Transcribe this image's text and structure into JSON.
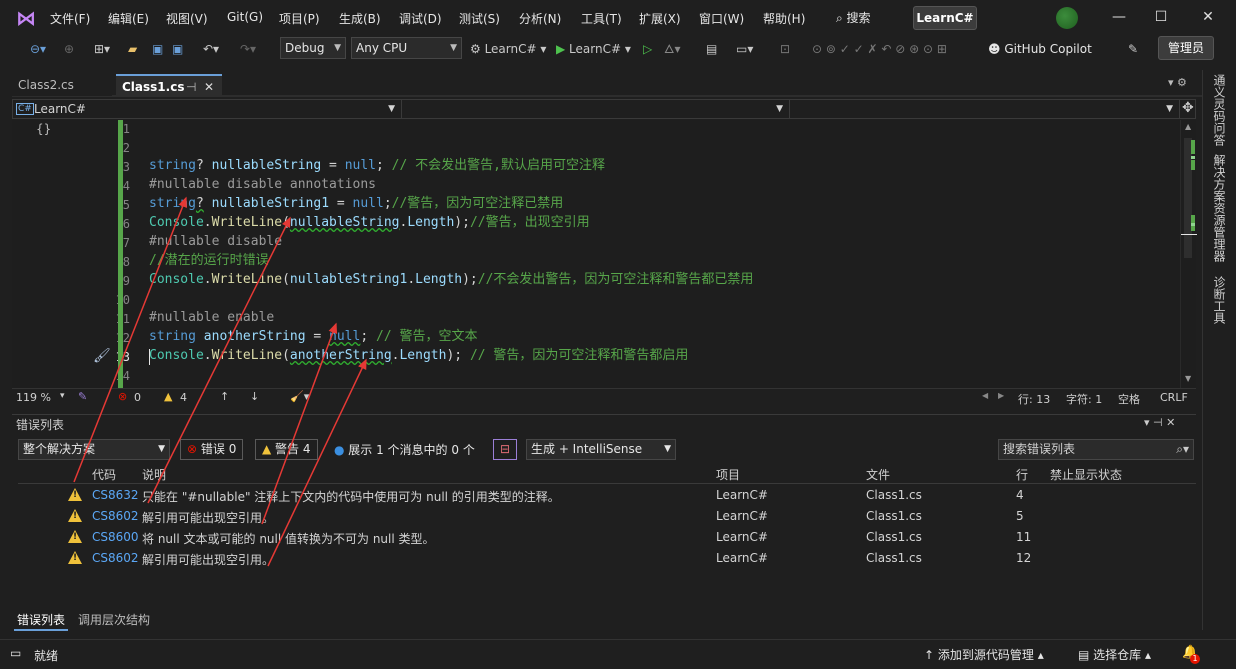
{
  "menu": [
    "文件(F)",
    "编辑(E)",
    "视图(V)",
    "Git(G)",
    "项目(P)",
    "生成(B)",
    "调试(D)",
    "测试(S)",
    "分析(N)",
    "工具(T)",
    "扩展(X)",
    "窗口(W)",
    "帮助(H)"
  ],
  "search_label": "搜索",
  "project_badge": "LearnC#",
  "toolbar": {
    "config": "Debug",
    "platform": "Any CPU",
    "startup_project": "LearnC#",
    "run_label": "LearnC#",
    "copilot": "GitHub Copilot",
    "admin": "管理员"
  },
  "tabs": [
    {
      "label": "Class2.cs",
      "active": false
    },
    {
      "label": "Class1.cs",
      "active": true
    }
  ],
  "right_dock": [
    "通义灵码问答",
    "解决方案资源管理器",
    "诊断工具"
  ],
  "navbar": {
    "project": "LearnC#",
    "type": "",
    "member": ""
  },
  "line_numbers": [
    "1",
    "2",
    "3",
    "4",
    "5",
    "6",
    "7",
    "8",
    "9",
    "10",
    "11",
    "12",
    "13",
    "14"
  ],
  "code_lines": [
    "",
    "string? nullableString = null; // 不会发出警告,默认启用可空注释",
    "#nullable disable annotations",
    "string? nullableString1 = null;//警告，因为可空注释已禁用",
    "Console.WriteLine(nullableString.Length);//警告，出现空引用",
    "#nullable disable",
    "//潜在的运行时错误",
    "Console.WriteLine(nullableString1.Length);//不会发出警告，因为可空注释和警告都已禁用",
    "",
    "#nullable enable",
    "string anotherString = null; // 警告，空文本",
    "Console.WriteLine(anotherString.Length); // 警告，因为可空注释和警告都启用",
    "",
    ""
  ],
  "editor_status": {
    "zoom": "119 %",
    "errors": "0",
    "warnings": "4",
    "line": "行: 13",
    "char": "字符: 1",
    "whitespace": "空格",
    "eol": "CRLF"
  },
  "error_list": {
    "title": "错误列表",
    "scope": "整个解决方案",
    "errors_btn": "错误 0",
    "warnings_btn": "警告 4",
    "messages": "展示 1 个消息中的 0 个",
    "build_filter": "生成 + IntelliSense",
    "search_placeholder": "搜索错误列表",
    "columns": [
      "代码",
      "说明",
      "项目",
      "文件",
      "行",
      "禁止显示状态"
    ],
    "rows": [
      {
        "code": "CS8632",
        "desc": "只能在 \"#nullable\" 注释上下文内的代码中使用可为 null 的引用类型的注释。",
        "project": "LearnC#",
        "file": "Class1.cs",
        "line": "4"
      },
      {
        "code": "CS8602",
        "desc": "解引用可能出现空引用。",
        "project": "LearnC#",
        "file": "Class1.cs",
        "line": "5"
      },
      {
        "code": "CS8600",
        "desc": "将 null 文本或可能的 null 值转换为不可为 null 类型。",
        "project": "LearnC#",
        "file": "Class1.cs",
        "line": "11"
      },
      {
        "code": "CS8602",
        "desc": "解引用可能出现空引用。",
        "project": "LearnC#",
        "file": "Class1.cs",
        "line": "12"
      }
    ]
  },
  "bottom_tabs": [
    "错误列表",
    "调用层次结构"
  ],
  "statusbar": {
    "ready": "就绪",
    "source_control": "添加到源代码管理",
    "repo": "选择仓库",
    "notifications": "1"
  },
  "colors": {
    "accent": "#6a9fd8",
    "warning": "#f0c23b",
    "error": "#e51400",
    "arrow": "#e53935",
    "change_bar": "#57a64a"
  }
}
